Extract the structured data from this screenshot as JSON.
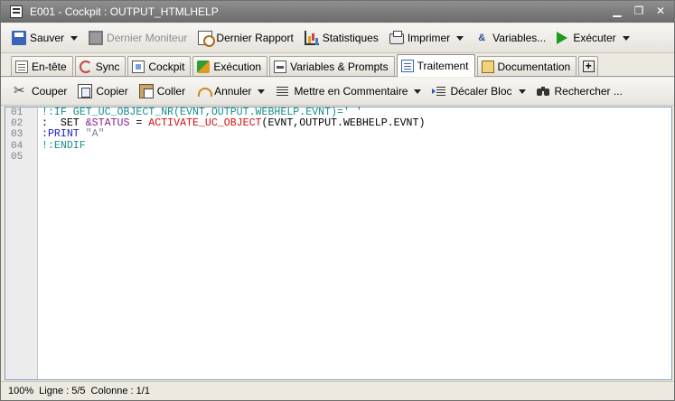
{
  "window": {
    "title": "E001 - Cockpit : OUTPUT_HTMLHELP"
  },
  "toolbar": {
    "save": "Sauver",
    "monitor": "Dernier Moniteur",
    "report": "Dernier Rapport",
    "stats": "Statistiques",
    "print": "Imprimer",
    "variables": "Variables...",
    "execute": "Exécuter"
  },
  "tabs": [
    {
      "label": "En-tête"
    },
    {
      "label": "Sync"
    },
    {
      "label": "Cockpit"
    },
    {
      "label": "Exécution"
    },
    {
      "label": "Variables & Prompts"
    },
    {
      "label": "Traitement"
    },
    {
      "label": "Documentation"
    }
  ],
  "edit_toolbar": {
    "cut": "Couper",
    "copy": "Copier",
    "paste": "Coller",
    "undo": "Annuler",
    "comment": "Mettre en Commentaire",
    "shift": "Décaler Bloc",
    "find": "Rechercher ..."
  },
  "editor": {
    "line_numbers": [
      "01",
      "02",
      "03",
      "04",
      "05"
    ],
    "lines": [
      {
        "tokens": [
          {
            "t": "!:IF GET_UC_OBJECT_NR(EVNT,OUTPUT.WEBHELP.EVNT)='",
            "c": "teal"
          },
          {
            "t": " '",
            "c": "teal"
          }
        ]
      },
      {
        "tokens": [
          {
            "t": ":  SET ",
            "c": "black"
          },
          {
            "t": "&STATUS",
            "c": "purple"
          },
          {
            "t": " = ",
            "c": "black"
          },
          {
            "t": "ACTIVATE_UC_OBJECT",
            "c": "red"
          },
          {
            "t": "(EVNT,OUTPUT.WEBHELP.EVNT)",
            "c": "black"
          }
        ]
      },
      {
        "tokens": [
          {
            "t": ":PRINT ",
            "c": "blue"
          },
          {
            "t": "\"A\"",
            "c": "str"
          }
        ]
      },
      {
        "tokens": [
          {
            "t": "!:ENDIF",
            "c": "teal"
          }
        ]
      },
      {
        "tokens": []
      }
    ]
  },
  "status": {
    "zoom": "100%",
    "line": "Ligne : 5/5",
    "column": "Colonne : 1/1"
  }
}
